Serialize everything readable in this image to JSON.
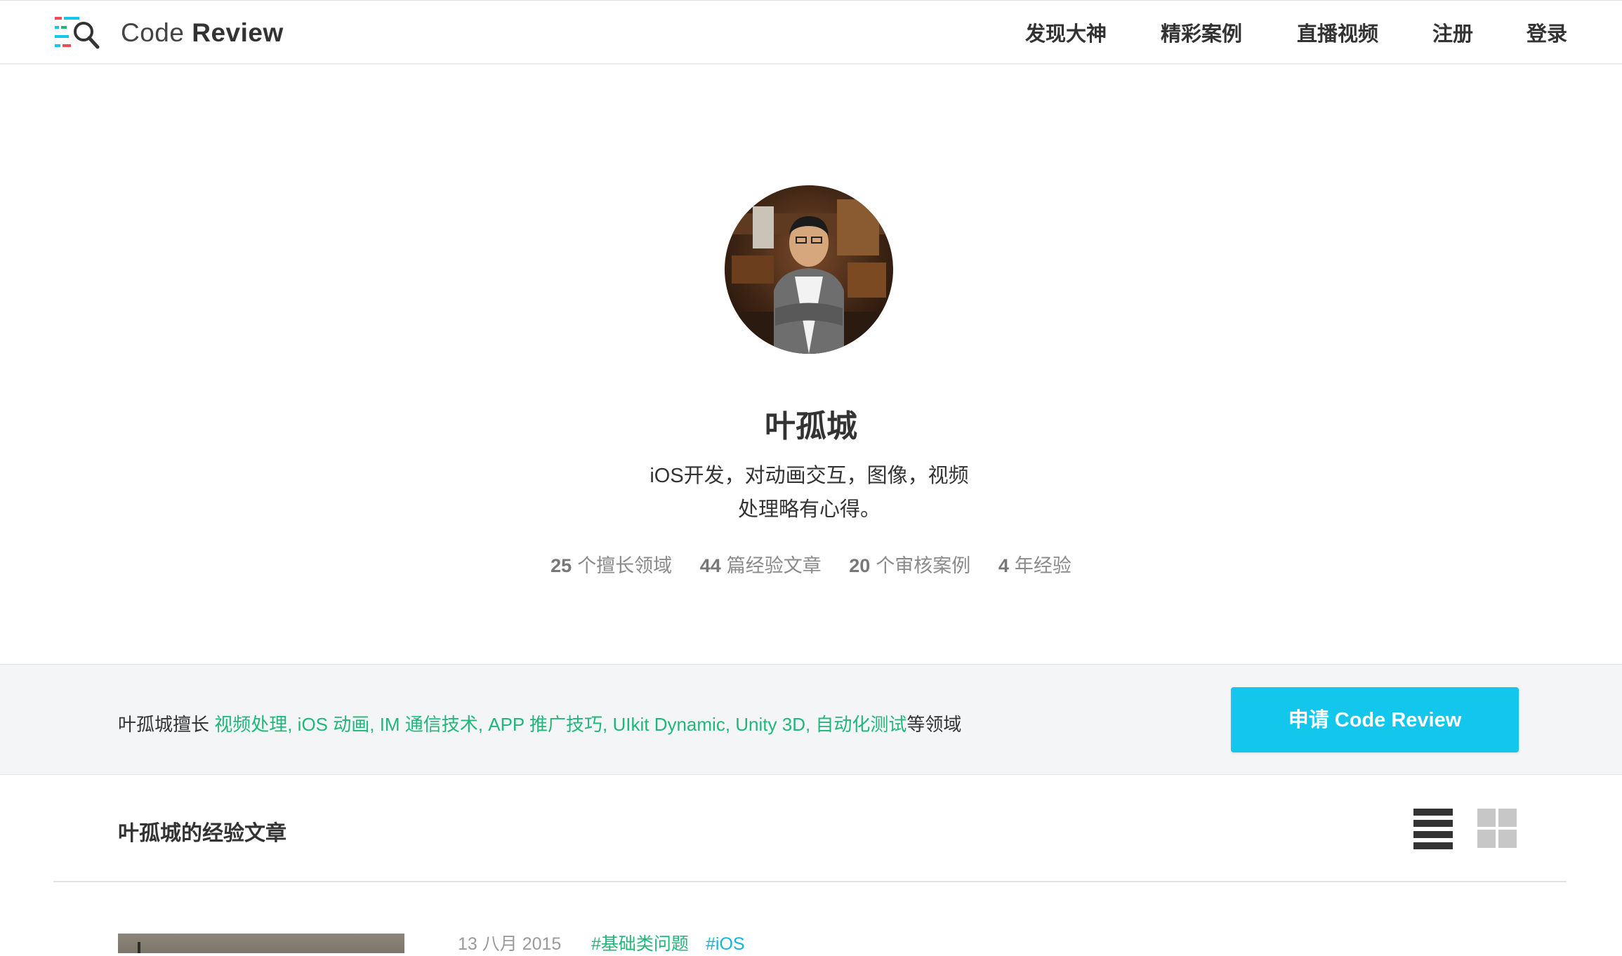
{
  "header": {
    "brand_light": "Code",
    "brand_bold": "Review",
    "nav": [
      "发现大神",
      "精彩案例",
      "直播视频",
      "注册",
      "登录"
    ]
  },
  "profile": {
    "name": "叶孤城",
    "bio_line1": "iOS开发，对动画交互，图像，视频",
    "bio_line2": "处理略有心得。",
    "stats": [
      {
        "num": "25",
        "label": "个擅长领域"
      },
      {
        "num": "44",
        "label": "篇经验文章"
      },
      {
        "num": "20",
        "label": "个审核案例"
      },
      {
        "num": "4",
        "label": "年经验"
      }
    ]
  },
  "skills": {
    "prefix": "叶孤城擅长 ",
    "list": "视频处理, iOS 动画, IM 通信技术, APP 推广技巧, UIkit Dynamic, Unity 3D, 自动化测试",
    "suffix": "等领域",
    "cta_label": "申请 Code Review"
  },
  "articles": {
    "section_title": "叶孤城的经验文章",
    "items": [
      {
        "date": "13 八月 2015",
        "tags": [
          "#基础类问题",
          "#iOS"
        ]
      }
    ]
  },
  "colors": {
    "accent": "#12c6ec",
    "tag_green": "#1fb87a",
    "tag_blue": "#12b5dc",
    "band_bg": "#f4f5f7"
  },
  "icons": {
    "logo": "magnifier-code-logo-icon",
    "view_list": "list-view-icon",
    "view_grid": "grid-view-icon"
  }
}
